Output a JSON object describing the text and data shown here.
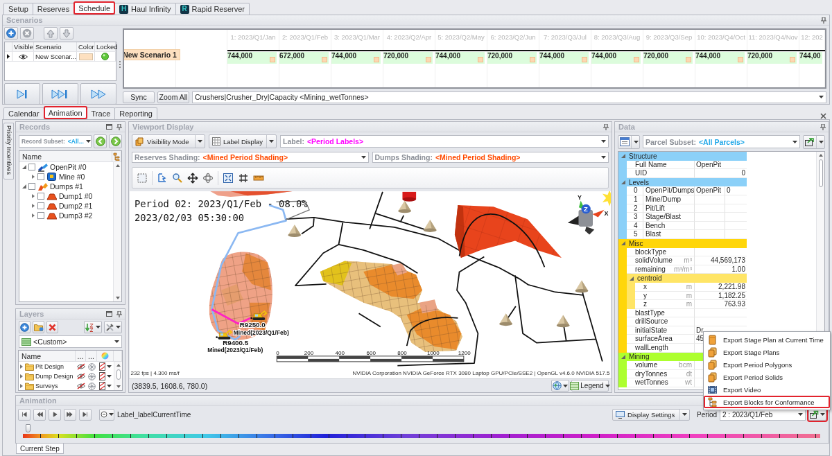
{
  "app_tabs": [
    {
      "label": "Setup",
      "selected": false,
      "highlighted": false
    },
    {
      "label": "Reserves",
      "selected": false,
      "highlighted": false
    },
    {
      "label": "Schedule",
      "selected": true,
      "highlighted": true
    },
    {
      "label": "Haul Infinity",
      "selected": false,
      "highlighted": false,
      "logo": "H"
    },
    {
      "label": "Rapid Reserver",
      "selected": false,
      "highlighted": false,
      "logo": "R"
    }
  ],
  "scenarios": {
    "title": "Scenarios",
    "columns": [
      "Visible",
      "Scenario",
      "Color",
      "Locked"
    ],
    "rows": [
      {
        "name": "New Scenar...",
        "current": true,
        "visible": true,
        "color": "#fde0c0"
      }
    ],
    "timeline": {
      "periods": [
        "1: 2023/Q1/Jan",
        "2: 2023/Q1/Feb",
        "3: 2023/Q1/Mar",
        "4: 2023/Q2/Apr",
        "5: 2023/Q2/May",
        "6: 2023/Q2/Jun",
        "7: 2023/Q3/Jul",
        "8: 2023/Q3/Aug",
        "9: 2023/Q3/Sep",
        "10: 2023/Q4/Oct",
        "11: 2023/Q4/Nov",
        "12: 202"
      ],
      "row_label": "New Scenario 1",
      "values": [
        "744,000",
        "672,000",
        "744,000",
        "720,000",
        "744,000",
        "720,000",
        "744,000",
        "744,000",
        "720,000",
        "744,000",
        "720,000",
        "744,00"
      ]
    },
    "sync_button": "Sync",
    "zoom_button": "Zoom All",
    "series_field": "Crushers|Crusher_Dry|Capacity <Mining_wetTonnes>"
  },
  "view_tabs": [
    {
      "label": "Calendar",
      "selected": false,
      "highlighted": false
    },
    {
      "label": "Animation",
      "selected": true,
      "highlighted": true
    },
    {
      "label": "Trace",
      "selected": false,
      "highlighted": false
    },
    {
      "label": "Reporting",
      "selected": false,
      "highlighted": false
    }
  ],
  "side_tabs": [
    {
      "label": "Priority Incentives"
    }
  ],
  "records": {
    "title": "Records",
    "subset_prefix": "Record Subset:",
    "subset_value": "<All...",
    "column": "Name",
    "tree": [
      {
        "label": "OpenPit #0",
        "kind": "pit",
        "checked": false,
        "expanded": true,
        "children": [
          {
            "label": "Mine #0",
            "kind": "mine",
            "checked": false,
            "expanded": false
          }
        ]
      },
      {
        "label": "Dumps #1",
        "kind": "dumps",
        "checked": false,
        "expanded": true,
        "children": [
          {
            "label": "Dump1 #0",
            "kind": "dump",
            "checked": false,
            "expanded": false
          },
          {
            "label": "Dump2 #1",
            "kind": "dump",
            "checked": false,
            "expanded": false
          },
          {
            "label": "Dump3 #2",
            "kind": "dump",
            "checked": false,
            "expanded": false
          }
        ]
      }
    ]
  },
  "layers": {
    "title": "Layers",
    "preset": "<Custom>",
    "columns": [
      "Name",
      "...",
      "..."
    ],
    "rows": [
      {
        "label": "Pit Design",
        "expanded": false
      },
      {
        "label": "Dump Design",
        "expanded": false
      },
      {
        "label": "Surveys",
        "expanded": false
      }
    ]
  },
  "viewport": {
    "title": "Viewport Display",
    "visibility_button": "Visibility Mode",
    "label_button": "Label Display",
    "label_combo": {
      "prefix": "Label:",
      "value": "<Period Labels>"
    },
    "shading_combos": [
      {
        "prefix": "Reserves Shading:",
        "value": "<Mined Period Shading>"
      },
      {
        "prefix": "Dumps Shading:",
        "value": "<Mined Period Shading>"
      }
    ],
    "overlay_lines": [
      "Period 02: 2023/Q1/Feb - 08.0%",
      "2023/02/03 05:30:00"
    ],
    "equipment_labels": [
      {
        "name": "R9250.0",
        "status": "Mined(2023/Q1/Feb)"
      },
      {
        "name": "R9400.5",
        "status": "Mined(2023/Q1/Feb)"
      }
    ],
    "axis_labels": [
      "Y",
      "Z",
      "X"
    ],
    "scale_ticks": [
      "0",
      "200",
      "400",
      "600",
      "800",
      "1000",
      "1200"
    ],
    "fps": "232 fps | 4.300 ms/f",
    "renderer": "NVIDIA Corporation NVIDIA GeForce RTX 3080 Laptop GPU/PCIe/SSE2 | OpenGL v4.6.0 NVIDIA 517.5",
    "coordinates": "(3839.5, 1608.6, 780.0)",
    "legend_button": "Legend"
  },
  "data": {
    "title": "Data",
    "subset_prefix": "Parcel Subset:",
    "subset_value": "<All Parcels>",
    "categories": [
      {
        "name": "Structure",
        "color": "#8bd0f8",
        "rows": [
          {
            "kind": "field",
            "label": "Full Name",
            "value": "OpenPit"
          },
          {
            "kind": "number",
            "label": "UID",
            "value": "0"
          }
        ]
      },
      {
        "name": "Levels",
        "color": "#8bd0f8",
        "rows": [
          {
            "kind": "level",
            "index": "0",
            "label": "OpenPit/Dumps",
            "value": "OpenPit",
            "value_2": "0"
          },
          {
            "kind": "level",
            "index": "1",
            "label": "Mine/Dump"
          },
          {
            "kind": "level",
            "index": "2",
            "label": "Pit/Lift"
          },
          {
            "kind": "level",
            "index": "3",
            "label": "Stage/Blast"
          },
          {
            "kind": "level",
            "index": "4",
            "label": "Bench"
          },
          {
            "kind": "level",
            "index": "5",
            "label": "Blast"
          }
        ]
      },
      {
        "name": "Misc",
        "color": "#ffd60a",
        "rows": [
          {
            "kind": "field",
            "label": "blockType"
          },
          {
            "kind": "number",
            "label": "solidVolume",
            "unit": "m³",
            "value": "44,569,173"
          },
          {
            "kind": "number",
            "label": "remaining",
            "unit": "m³/m³",
            "value": "1.00"
          },
          {
            "kind": "group",
            "label": "centroid",
            "color": "#ffe566",
            "rows": [
              {
                "kind": "number",
                "label": "x",
                "unit": "m",
                "value": "2,221.98"
              },
              {
                "kind": "number",
                "label": "y",
                "unit": "m",
                "value": "1,182.25"
              },
              {
                "kind": "number",
                "label": "z",
                "unit": "m",
                "value": "763.93"
              }
            ]
          },
          {
            "kind": "field",
            "label": "blastType"
          },
          {
            "kind": "field",
            "label": "drillSource"
          },
          {
            "kind": "field",
            "label": "initialState",
            "value": "Dr"
          },
          {
            "kind": "field",
            "label": "surfaceArea",
            "value": "45"
          },
          {
            "kind": "field",
            "label": "wallLength"
          }
        ]
      },
      {
        "name": "Mining",
        "color": "#adff2f",
        "rows": [
          {
            "kind": "number",
            "label": "volume",
            "unit": "bcm"
          },
          {
            "kind": "number",
            "label": "dryTonnes",
            "unit": "dt"
          },
          {
            "kind": "number",
            "label": "wetTonnes",
            "unit": "wt"
          }
        ]
      }
    ]
  },
  "export_menu": [
    {
      "label": "Export Stage Plan at Current Time",
      "kind": "box",
      "highlighted": false
    },
    {
      "label": "Export Stage Plans",
      "kind": "boxes",
      "highlighted": false
    },
    {
      "label": "Export Period Polygons",
      "kind": "boxes",
      "highlighted": false
    },
    {
      "label": "Export Period Solids",
      "kind": "boxes",
      "highlighted": false
    },
    {
      "label": "Export Video",
      "kind": "video",
      "highlighted": false
    },
    {
      "label": "Export Blocks for Conformance",
      "kind": "tree",
      "highlighted": true
    }
  ],
  "animation": {
    "title": "Animation",
    "time_label": "Label_labelCurrentTime",
    "display_settings": "Display Settings",
    "period_label": "Period",
    "period_value": "2 : 2023/Q1/Feb",
    "export_highlighted": true,
    "level": 0.004
  },
  "bottom_tabs": [
    {
      "label": "Current Step",
      "selected": true
    }
  ]
}
